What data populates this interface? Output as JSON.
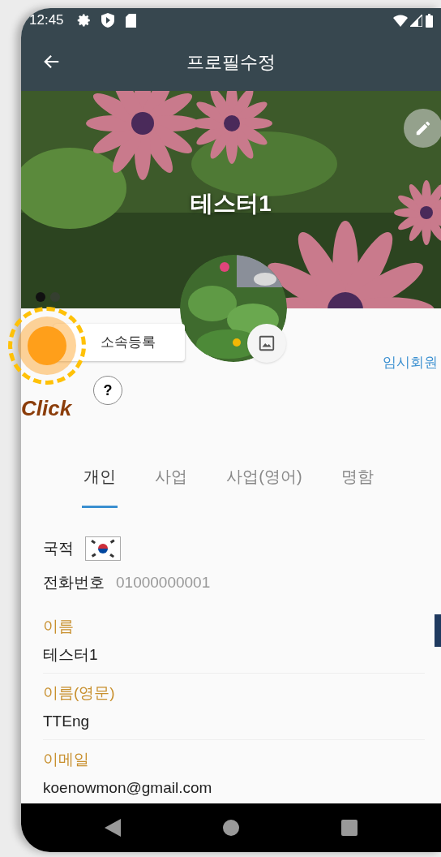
{
  "status_bar": {
    "time": "12:45"
  },
  "toolbar": {
    "title": "프로필수정"
  },
  "cover": {
    "kind": "picture",
    "name": "테스터1",
    "page_dots": [
      {
        "selected": true
      },
      {
        "selected": false
      }
    ]
  },
  "profile": {
    "affiliation_button": "소속등록",
    "help_button": "?",
    "member_type": "임시회원"
  },
  "annotation": {
    "label": "Click"
  },
  "tabs": [
    {
      "label": "개인",
      "selected": true
    },
    {
      "label": "사업",
      "selected": false
    },
    {
      "label": "사업(영어)",
      "selected": false
    },
    {
      "label": "명함",
      "selected": false
    }
  ],
  "info": [
    {
      "kind": "flag",
      "label": "국적"
    },
    {
      "kind": "text",
      "label": "전화번호",
      "value": "01000000001"
    }
  ],
  "fields": [
    {
      "label": "이름",
      "value": "테스터1"
    },
    {
      "label": "이름(영문)",
      "value": "TTEng"
    },
    {
      "label": "이메일",
      "value": "koenowmon@gmail.com"
    }
  ]
}
